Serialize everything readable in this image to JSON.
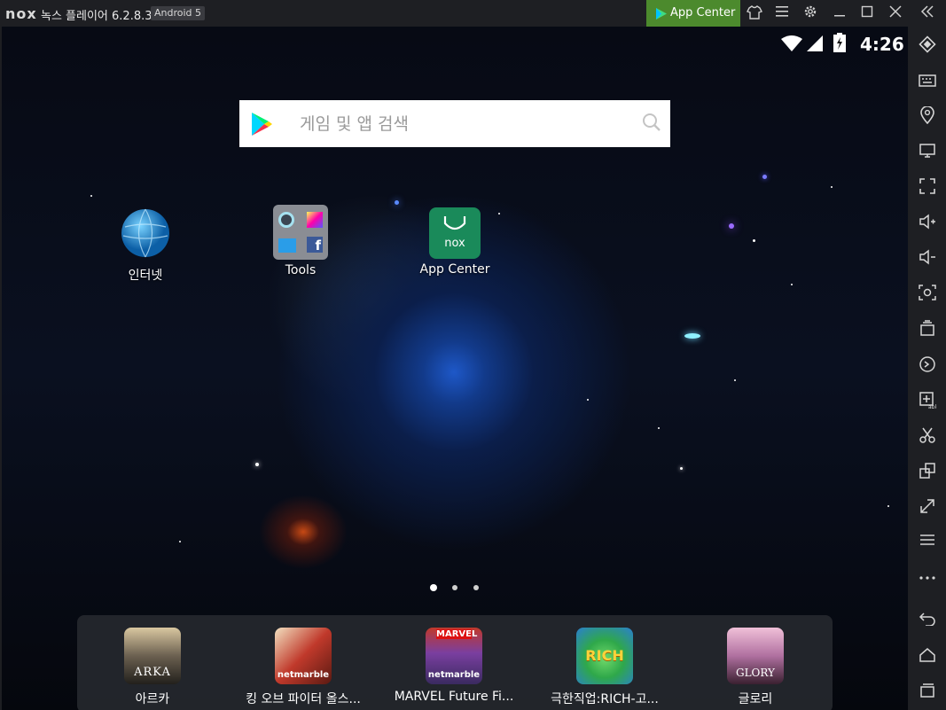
{
  "titlebar": {
    "logo": "nox",
    "title": "녹스 플레이어 6.2.8.3",
    "android_badge": "Android 5",
    "app_center_label": "App Center"
  },
  "statusbar": {
    "time": "4:26"
  },
  "search": {
    "placeholder": "게임 및 앱 검색"
  },
  "desktop": {
    "apps": [
      {
        "label": "인터넷"
      },
      {
        "label": "Tools"
      },
      {
        "label": "App Center"
      }
    ]
  },
  "dock": {
    "apps": [
      {
        "label": "아르카",
        "icon_text": "ARKA"
      },
      {
        "label": "킹 오브 파이터 올스...",
        "icon_text": "netmarble"
      },
      {
        "label": "MARVEL Future Fi...",
        "icon_text": "netmarble",
        "icon_top": "MARVEL"
      },
      {
        "label": "극한직업:RICH-고...",
        "icon_text": "RICH"
      },
      {
        "label": "글로리",
        "icon_text": "GLORY"
      }
    ]
  },
  "colors": {
    "accent_green": "#4c8a2d",
    "appcenter_icon": "#1a8a5a"
  }
}
